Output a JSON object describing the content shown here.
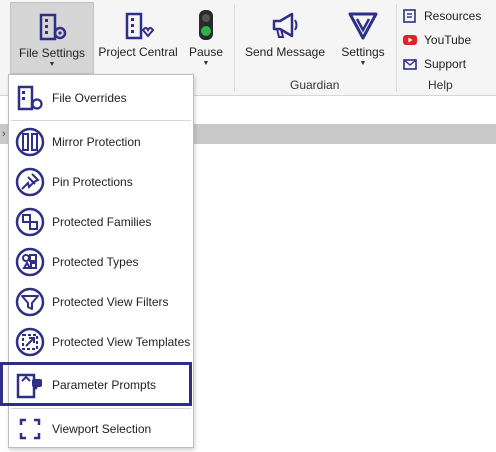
{
  "ribbon": {
    "file_settings": "File Settings",
    "project_central": "Project Central",
    "pause": "Pause",
    "send_message": "Send Message",
    "settings": "Settings",
    "group_guardian": "Guardian",
    "group_help": "Help",
    "help_links": {
      "resources": "Resources",
      "youtube": "YouTube",
      "support": "Support"
    },
    "caret": "▼"
  },
  "menu": {
    "items": [
      {
        "label": "File Overrides",
        "icon": "file-overrides-icon"
      },
      {
        "label": "Mirror Protection",
        "icon": "mirror-protection-icon"
      },
      {
        "label": "Pin Protections",
        "icon": "pin-icon"
      },
      {
        "label": "Protected Families",
        "icon": "families-icon"
      },
      {
        "label": "Protected Types",
        "icon": "types-icon"
      },
      {
        "label": "Protected View Filters",
        "icon": "view-filter-icon"
      },
      {
        "label": "Protected View Templates",
        "icon": "view-template-icon"
      },
      {
        "label": "Parameter Prompts",
        "icon": "parameter-prompts-icon"
      },
      {
        "label": "Viewport Selection",
        "icon": "viewport-selection-icon"
      }
    ]
  },
  "colors": {
    "brand_navy": "#2e2f86",
    "youtube_red": "#e02424",
    "traffic_green": "#2bb24c"
  },
  "collapse_arrow": "›"
}
